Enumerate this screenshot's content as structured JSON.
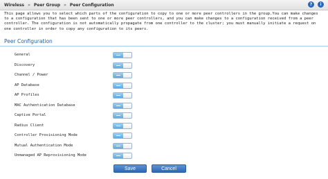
{
  "breadcrumb": [
    "Wireless",
    "Peer Group",
    "Peer Configuration"
  ],
  "breadcrumb_separator": "»",
  "header_icons": [
    {
      "name": "help-icon",
      "glyph": "?"
    },
    {
      "name": "info-icon",
      "glyph": "i"
    }
  ],
  "intro_text": "This page allows you to select which parts of the configuration to copy to one or more peer controllers in the group.You can make changes to a configuration that has been sent to one or more peer controllers, and you can make changes to a configuration received from a peer controller. The configuration is not automatically propagate from one controller to the cluster; you must manually initiate a request on one controller in order to copy any configuration to its peers.",
  "section_title": "Peer Configuration",
  "items": [
    {
      "label": "General",
      "enabled": true
    },
    {
      "label": "Discovery",
      "enabled": true
    },
    {
      "label": "Channel / Power",
      "enabled": true
    },
    {
      "label": "AP Database",
      "enabled": true
    },
    {
      "label": "AP Profiles",
      "enabled": true
    },
    {
      "label": "MAC Authentication Database",
      "enabled": true
    },
    {
      "label": "Captive Portal",
      "enabled": true
    },
    {
      "label": "Radius Client",
      "enabled": true
    },
    {
      "label": "Controller Provisioning Mode",
      "enabled": true
    },
    {
      "label": "Mutual Authentication Mode",
      "enabled": true
    },
    {
      "label": "Unmanaged AP Reprovisioning Mode",
      "enabled": true
    }
  ],
  "buttons": {
    "save": "Save",
    "cancel": "Cancel"
  },
  "colors": {
    "accent": "#2461a8",
    "toggle_on": "#5aa9e3",
    "button": "#2f67b5"
  }
}
